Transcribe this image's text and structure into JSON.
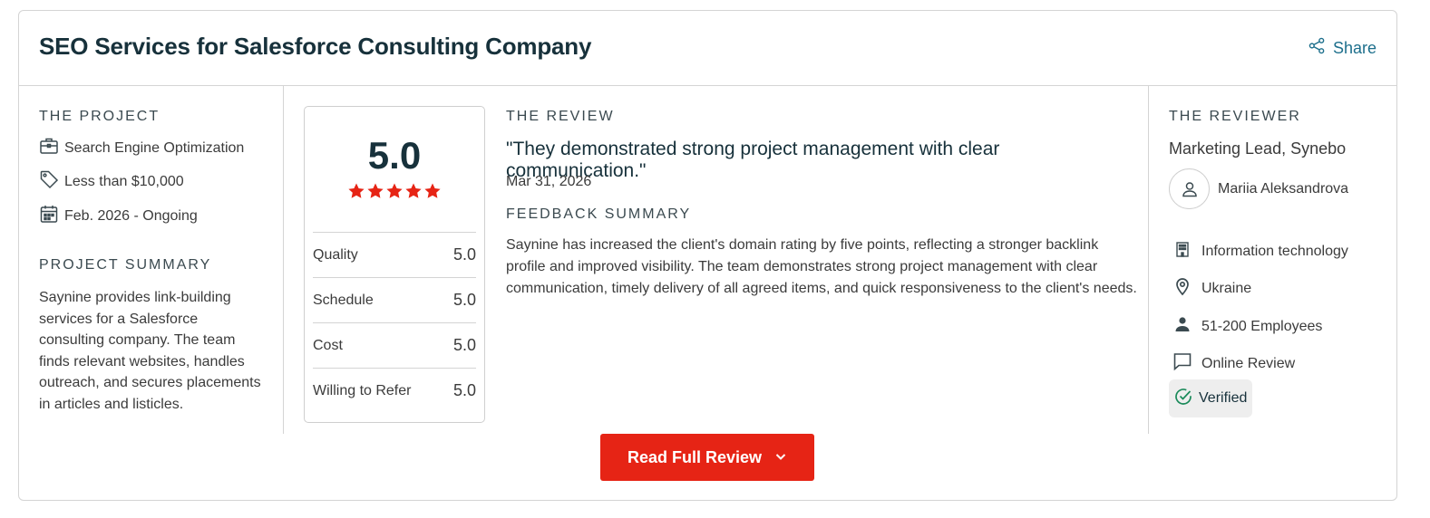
{
  "header": {
    "title": "SEO Services for Salesforce Consulting Company",
    "share_label": "Share"
  },
  "project": {
    "label": "THE PROJECT",
    "items": [
      {
        "icon": "briefcase-icon",
        "text": "Search Engine Optimization"
      },
      {
        "icon": "price-tag-icon",
        "text": "Less than $10,000"
      },
      {
        "icon": "calendar-icon",
        "text": "Feb. 2026 - Ongoing"
      }
    ],
    "summary_label": "PROJECT SUMMARY",
    "summary": "Saynine provides link-building services for a Salesforce consulting company. The team finds relevant websites, handles outreach, and secures placements in articles and listicles."
  },
  "rating": {
    "overall": "5.0",
    "stars": 5,
    "star_color": "#e62415",
    "rows": [
      {
        "label": "Quality",
        "value": "5.0"
      },
      {
        "label": "Schedule",
        "value": "5.0"
      },
      {
        "label": "Cost",
        "value": "5.0"
      },
      {
        "label": "Willing to Refer",
        "value": "5.0"
      }
    ]
  },
  "review": {
    "label": "THE REVIEW",
    "quote": "\"They demonstrated strong project management with clear communication.\"",
    "date": "Mar 31, 2026",
    "feedback_label": "FEEDBACK SUMMARY",
    "feedback": "Saynine has increased the client's domain rating by five points, reflecting a stronger backlink profile and improved visibility. The team demonstrates strong project management with clear communication, timely delivery of all agreed items, and quick responsiveness to the client's needs."
  },
  "reviewer": {
    "label": "THE REVIEWER",
    "role": "Marketing Lead, Synebo",
    "name": "Mariia Aleksandrova",
    "details": [
      {
        "icon": "building-icon",
        "text": "Information technology"
      },
      {
        "icon": "location-pin-icon",
        "text": "Ukraine"
      },
      {
        "icon": "person-icon",
        "text": "51-200 Employees"
      },
      {
        "icon": "chat-bubble-icon",
        "text": "Online Review"
      }
    ],
    "verified_label": "Verified"
  },
  "cta": {
    "label": "Read Full Review",
    "color": "#e62415"
  },
  "colors": {
    "heading": "#17313b",
    "accent_link": "#1d6f8c",
    "verified_green": "#1a8a5a"
  }
}
